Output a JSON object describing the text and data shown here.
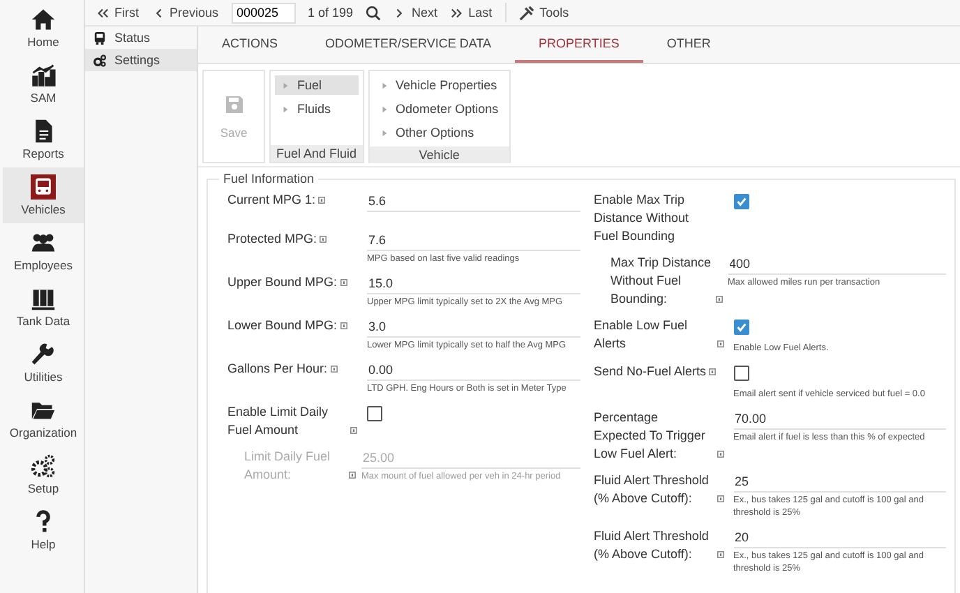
{
  "nav": [
    {
      "label": "Home",
      "selected": false
    },
    {
      "label": "SAM",
      "selected": false
    },
    {
      "label": "Reports",
      "selected": false
    },
    {
      "label": "Vehicles",
      "selected": true
    },
    {
      "label": "Employees",
      "selected": false
    },
    {
      "label": "Tank Data",
      "selected": false
    },
    {
      "label": "Utilities",
      "selected": false
    },
    {
      "label": "Organization",
      "selected": false
    },
    {
      "label": "Setup",
      "selected": false
    },
    {
      "label": "Help",
      "selected": false
    }
  ],
  "toolbar": {
    "first": "First",
    "previous": "Previous",
    "record": "000025",
    "count": "1 of 199",
    "next": "Next",
    "last": "Last",
    "tools": "Tools"
  },
  "subnav": [
    {
      "label": "Status",
      "selected": false
    },
    {
      "label": "Settings",
      "selected": true
    }
  ],
  "tabs": [
    {
      "label": "ACTIONS",
      "selected": false
    },
    {
      "label": "ODOMETER/SERVICE DATA",
      "selected": false
    },
    {
      "label": "PROPERTIES",
      "selected": true
    },
    {
      "label": "OTHER",
      "selected": false
    }
  ],
  "ribbon": {
    "save": {
      "label": "Save",
      "disabled": true
    },
    "groups": [
      {
        "title": "Fuel And Fluid",
        "items": [
          {
            "label": "Fuel",
            "selected": true
          },
          {
            "label": "Fluids",
            "selected": false
          }
        ]
      },
      {
        "title": "Vehicle",
        "items": [
          {
            "label": "Vehicle Properties",
            "selected": false
          },
          {
            "label": "Odometer Options",
            "selected": false
          },
          {
            "label": "Other Options",
            "selected": false
          }
        ]
      }
    ]
  },
  "section": {
    "legend": "Fuel Information",
    "left": [
      {
        "kind": "input",
        "label": "Current MPG 1:",
        "help": true,
        "value": "5.6"
      },
      {
        "kind": "input",
        "label": "Protected MPG:",
        "help": true,
        "value": "7.6",
        "hint": "MPG based on last five valid readings"
      },
      {
        "kind": "input",
        "label": "Upper Bound MPG:",
        "help": true,
        "value": "15.0",
        "hint": "Upper MPG limit typically set to 2X the Avg MPG"
      },
      {
        "kind": "input",
        "label": "Lower Bound MPG:",
        "help": true,
        "value": "3.0",
        "hint": "Lower MPG limit typically set to half the Avg MPG"
      },
      {
        "kind": "input",
        "label": "Gallons Per Hour:",
        "help": true,
        "value": "0.00",
        "hint": "LTD GPH. Eng Hours or Both is set in Meter Type"
      },
      {
        "kind": "checkbox",
        "label": "Enable Limit Daily Fuel Amount",
        "help": true,
        "checked": false
      },
      {
        "kind": "input",
        "label": "Limit Daily Fuel Amount:",
        "help": true,
        "value": "25.00",
        "hint": "Max mount of fuel allowed per veh in 24-hr period",
        "indented": true,
        "disabled": true
      }
    ],
    "right": [
      {
        "kind": "checkbox",
        "label": "Enable Max Trip Distance Without Fuel Bounding",
        "help": false,
        "checked": true
      },
      {
        "kind": "input",
        "label": "Max Trip Distance Without Fuel Bounding:",
        "help": true,
        "value": "400",
        "hint": "Max allowed miles run per transaction",
        "indented": true,
        "disabled": false
      },
      {
        "kind": "checkbox",
        "label": "Enable Low Fuel Alerts",
        "help": true,
        "checked": true,
        "hint": "Enable Low Fuel Alerts."
      },
      {
        "kind": "checkbox",
        "label": "Send No-Fuel Alerts",
        "help": true,
        "checked": false,
        "hint": "Email alert sent if vehicle serviced but fuel = 0.0"
      },
      {
        "kind": "input",
        "label": "Percentage Expected To Trigger Low Fuel Alert:",
        "help": true,
        "value": "70.00",
        "hint": "Email alert if fuel is less than this % of expected"
      },
      {
        "kind": "input",
        "label": "Fluid Alert Threshold (% Above Cutoff):",
        "help": true,
        "value": "25",
        "hint": "Ex., bus takes 125 gal and cutoff is 100 gal and threshold is 25%"
      },
      {
        "kind": "input",
        "label": "Fluid Alert Threshold (% Above Cutoff):",
        "help": true,
        "value": "20",
        "hint": "Ex., bus takes 125 gal and cutoff is 100 gal and threshold is 25%"
      }
    ]
  }
}
